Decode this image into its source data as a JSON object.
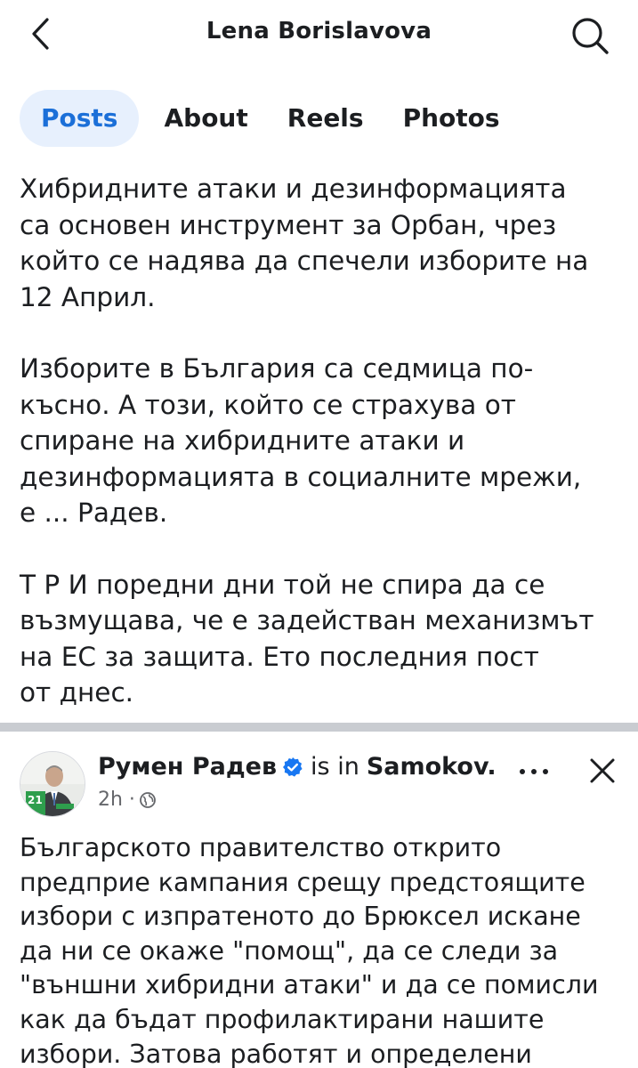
{
  "header": {
    "back_icon": "chevron-left-icon",
    "title": "Lena Borislavova",
    "search_icon": "search-icon"
  },
  "tabs": [
    {
      "label": "Posts",
      "active": true
    },
    {
      "label": "About",
      "active": false
    },
    {
      "label": "Reels",
      "active": false
    },
    {
      "label": "Photos",
      "active": false
    }
  ],
  "post": {
    "paragraphs": [
      "Хибридните атаки и дезинформацията\nса основен инструмент за Орбан, чрез\nкойто се надява да спечели изборите на\n12 Април.",
      "Изборите в България са седмица по-\nкъсно. А този, който се страхува от\nспиране на хибридните атаки и\nдезинформацията в социалните мрежи,\nе ... Радев.",
      "Т Р И  поредни дни той не спира да се\nвъзмущава, че е задействан механизмът\nна ЕС за защита. Ето последния пост\nот днес."
    ]
  },
  "shared_post": {
    "author": "Румен Радев",
    "verified_icon": "verified-badge-icon",
    "is_in": "is in",
    "location": "Samokov.",
    "time": "2h ·",
    "audience_icon": "globe-icon",
    "more_icon": "more-dots-icon",
    "close_icon": "close-icon",
    "avatar_badge": "21",
    "text": "Българското правителство открито\nпредприе кампания срещу предстоящите\nизбори с изпратеното до Брюксел искане\nда ни се окаже \"помощ\", да се следи за\n\"външни хибридни атаки\" и да се помисли\nкак да бъдат профилактирани нашите\nизбори. Затова работят и определени"
  },
  "colors": {
    "accent": "#1b6fd8",
    "active_tab_bg": "#e7f0fd",
    "divider": "#c9ccd1",
    "secondary_text": "#65676b",
    "verified": "#1877f2"
  }
}
